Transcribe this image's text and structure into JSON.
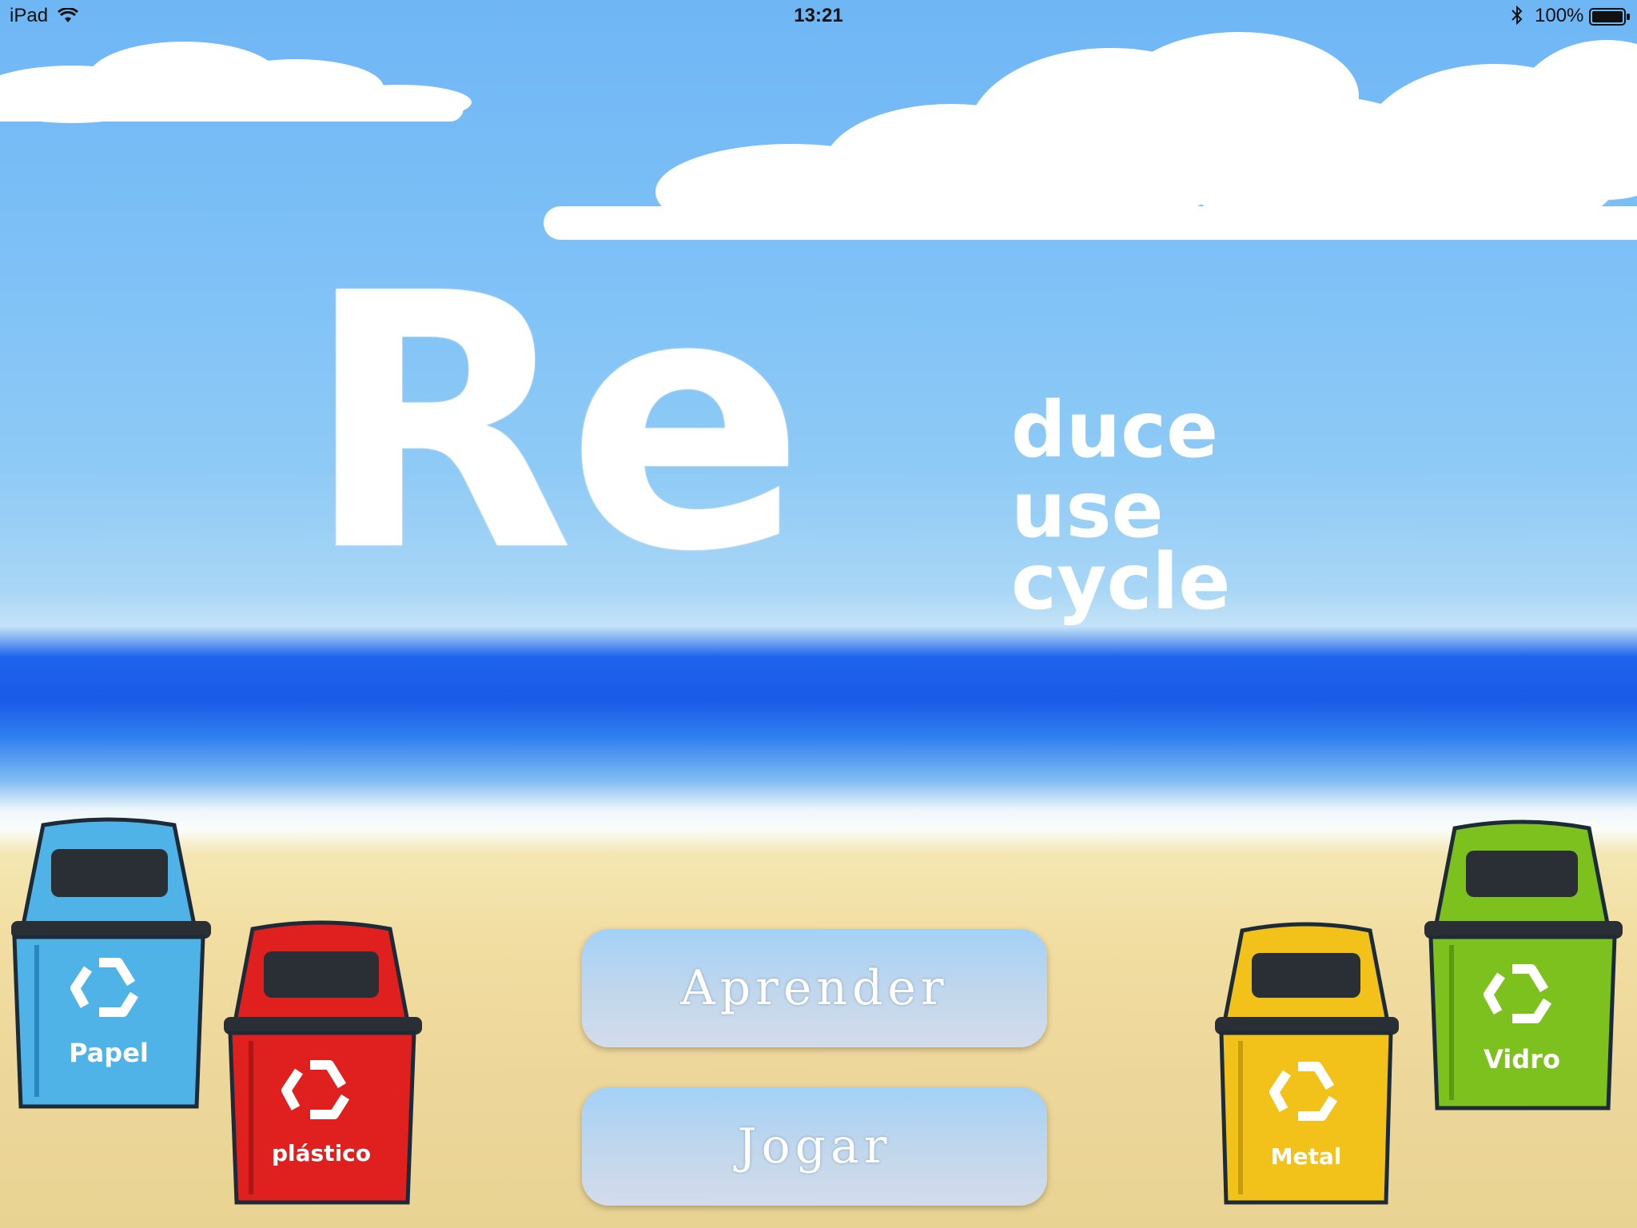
{
  "status_bar": {
    "device": "iPad",
    "wifi_icon": "wifi-icon",
    "time": "13:21",
    "bluetooth_icon": "bluetooth-icon",
    "battery": "100%",
    "battery_icon": "battery-full-icon"
  },
  "logo": {
    "prefix": "Re",
    "suffixes": [
      "duce",
      "use",
      "cycle"
    ]
  },
  "menu": {
    "learn_label": "Aprender",
    "play_label": "Jogar"
  },
  "bins": [
    {
      "label": "Papel",
      "color": "#4fb3e8",
      "icon": "recycle-icon"
    },
    {
      "label": "plástico",
      "color": "#e01f1f",
      "icon": "recycle-icon"
    },
    {
      "label": "Metal",
      "color": "#f2c21a",
      "icon": "recycle-icon"
    },
    {
      "label": "Vidro",
      "color": "#7cc11e",
      "icon": "recycle-icon"
    }
  ]
}
